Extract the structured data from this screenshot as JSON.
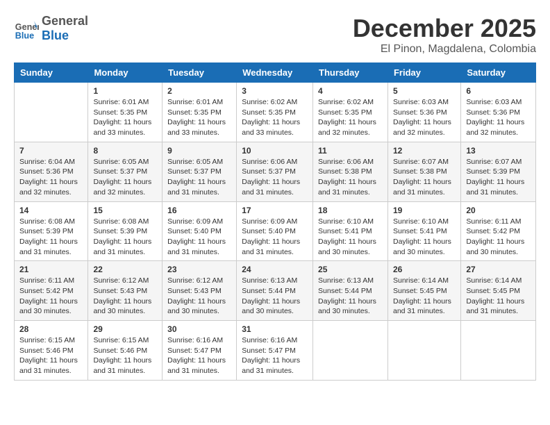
{
  "header": {
    "logo_general": "General",
    "logo_blue": "Blue",
    "month_title": "December 2025",
    "location": "El Pinon, Magdalena, Colombia"
  },
  "days_of_week": [
    "Sunday",
    "Monday",
    "Tuesday",
    "Wednesday",
    "Thursday",
    "Friday",
    "Saturday"
  ],
  "weeks": [
    [
      {
        "day": "",
        "info": ""
      },
      {
        "day": "1",
        "info": "Sunrise: 6:01 AM\nSunset: 5:35 PM\nDaylight: 11 hours\nand 33 minutes."
      },
      {
        "day": "2",
        "info": "Sunrise: 6:01 AM\nSunset: 5:35 PM\nDaylight: 11 hours\nand 33 minutes."
      },
      {
        "day": "3",
        "info": "Sunrise: 6:02 AM\nSunset: 5:35 PM\nDaylight: 11 hours\nand 33 minutes."
      },
      {
        "day": "4",
        "info": "Sunrise: 6:02 AM\nSunset: 5:35 PM\nDaylight: 11 hours\nand 32 minutes."
      },
      {
        "day": "5",
        "info": "Sunrise: 6:03 AM\nSunset: 5:36 PM\nDaylight: 11 hours\nand 32 minutes."
      },
      {
        "day": "6",
        "info": "Sunrise: 6:03 AM\nSunset: 5:36 PM\nDaylight: 11 hours\nand 32 minutes."
      }
    ],
    [
      {
        "day": "7",
        "info": "Sunrise: 6:04 AM\nSunset: 5:36 PM\nDaylight: 11 hours\nand 32 minutes."
      },
      {
        "day": "8",
        "info": "Sunrise: 6:05 AM\nSunset: 5:37 PM\nDaylight: 11 hours\nand 32 minutes."
      },
      {
        "day": "9",
        "info": "Sunrise: 6:05 AM\nSunset: 5:37 PM\nDaylight: 11 hours\nand 31 minutes."
      },
      {
        "day": "10",
        "info": "Sunrise: 6:06 AM\nSunset: 5:37 PM\nDaylight: 11 hours\nand 31 minutes."
      },
      {
        "day": "11",
        "info": "Sunrise: 6:06 AM\nSunset: 5:38 PM\nDaylight: 11 hours\nand 31 minutes."
      },
      {
        "day": "12",
        "info": "Sunrise: 6:07 AM\nSunset: 5:38 PM\nDaylight: 11 hours\nand 31 minutes."
      },
      {
        "day": "13",
        "info": "Sunrise: 6:07 AM\nSunset: 5:39 PM\nDaylight: 11 hours\nand 31 minutes."
      }
    ],
    [
      {
        "day": "14",
        "info": "Sunrise: 6:08 AM\nSunset: 5:39 PM\nDaylight: 11 hours\nand 31 minutes."
      },
      {
        "day": "15",
        "info": "Sunrise: 6:08 AM\nSunset: 5:39 PM\nDaylight: 11 hours\nand 31 minutes."
      },
      {
        "day": "16",
        "info": "Sunrise: 6:09 AM\nSunset: 5:40 PM\nDaylight: 11 hours\nand 31 minutes."
      },
      {
        "day": "17",
        "info": "Sunrise: 6:09 AM\nSunset: 5:40 PM\nDaylight: 11 hours\nand 31 minutes."
      },
      {
        "day": "18",
        "info": "Sunrise: 6:10 AM\nSunset: 5:41 PM\nDaylight: 11 hours\nand 30 minutes."
      },
      {
        "day": "19",
        "info": "Sunrise: 6:10 AM\nSunset: 5:41 PM\nDaylight: 11 hours\nand 30 minutes."
      },
      {
        "day": "20",
        "info": "Sunrise: 6:11 AM\nSunset: 5:42 PM\nDaylight: 11 hours\nand 30 minutes."
      }
    ],
    [
      {
        "day": "21",
        "info": "Sunrise: 6:11 AM\nSunset: 5:42 PM\nDaylight: 11 hours\nand 30 minutes."
      },
      {
        "day": "22",
        "info": "Sunrise: 6:12 AM\nSunset: 5:43 PM\nDaylight: 11 hours\nand 30 minutes."
      },
      {
        "day": "23",
        "info": "Sunrise: 6:12 AM\nSunset: 5:43 PM\nDaylight: 11 hours\nand 30 minutes."
      },
      {
        "day": "24",
        "info": "Sunrise: 6:13 AM\nSunset: 5:44 PM\nDaylight: 11 hours\nand 30 minutes."
      },
      {
        "day": "25",
        "info": "Sunrise: 6:13 AM\nSunset: 5:44 PM\nDaylight: 11 hours\nand 30 minutes."
      },
      {
        "day": "26",
        "info": "Sunrise: 6:14 AM\nSunset: 5:45 PM\nDaylight: 11 hours\nand 31 minutes."
      },
      {
        "day": "27",
        "info": "Sunrise: 6:14 AM\nSunset: 5:45 PM\nDaylight: 11 hours\nand 31 minutes."
      }
    ],
    [
      {
        "day": "28",
        "info": "Sunrise: 6:15 AM\nSunset: 5:46 PM\nDaylight: 11 hours\nand 31 minutes."
      },
      {
        "day": "29",
        "info": "Sunrise: 6:15 AM\nSunset: 5:46 PM\nDaylight: 11 hours\nand 31 minutes."
      },
      {
        "day": "30",
        "info": "Sunrise: 6:16 AM\nSunset: 5:47 PM\nDaylight: 11 hours\nand 31 minutes."
      },
      {
        "day": "31",
        "info": "Sunrise: 6:16 AM\nSunset: 5:47 PM\nDaylight: 11 hours\nand 31 minutes."
      },
      {
        "day": "",
        "info": ""
      },
      {
        "day": "",
        "info": ""
      },
      {
        "day": "",
        "info": ""
      }
    ]
  ]
}
